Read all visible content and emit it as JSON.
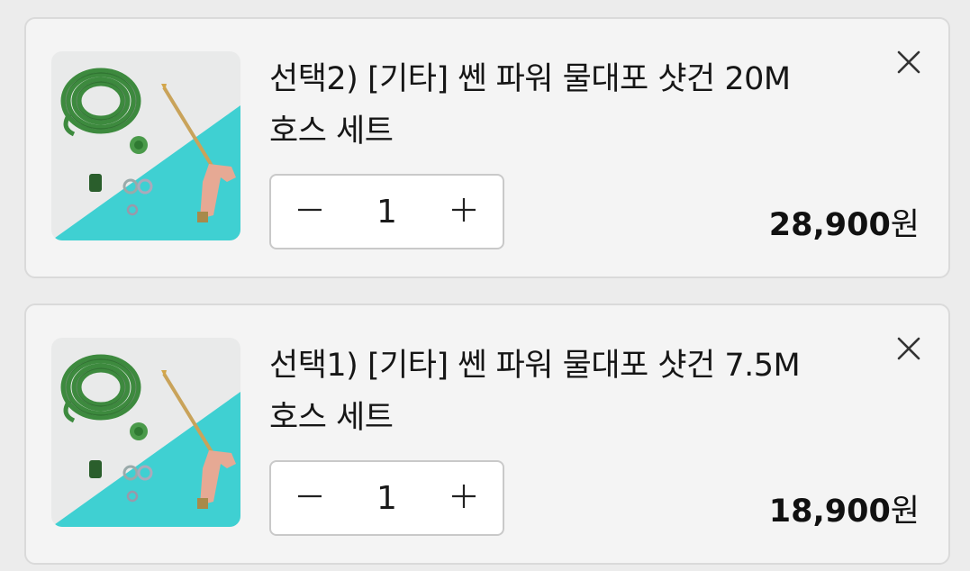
{
  "items": [
    {
      "title_line1": "선택2) [기타] 쎈 파워 물대포 샷건 20M",
      "title_line2": "호스 세트",
      "quantity": "1",
      "price": "28,900",
      "currency": "원",
      "icons": {
        "remove": "close-icon",
        "decrease": "minus-icon",
        "increase": "plus-icon"
      }
    },
    {
      "title_line1": "선택1) [기타] 쎈 파워 물대포 샷건 7.5M",
      "title_line2": "호스 세트",
      "quantity": "1",
      "price": "18,900",
      "currency": "원",
      "icons": {
        "remove": "close-icon",
        "decrease": "minus-icon",
        "increase": "plus-icon"
      }
    }
  ],
  "colors": {
    "page_background": "#ececec",
    "card_background": "#f4f4f4",
    "hose_green": "#3d8a3e",
    "backdrop_teal": "#3fd0d2"
  }
}
